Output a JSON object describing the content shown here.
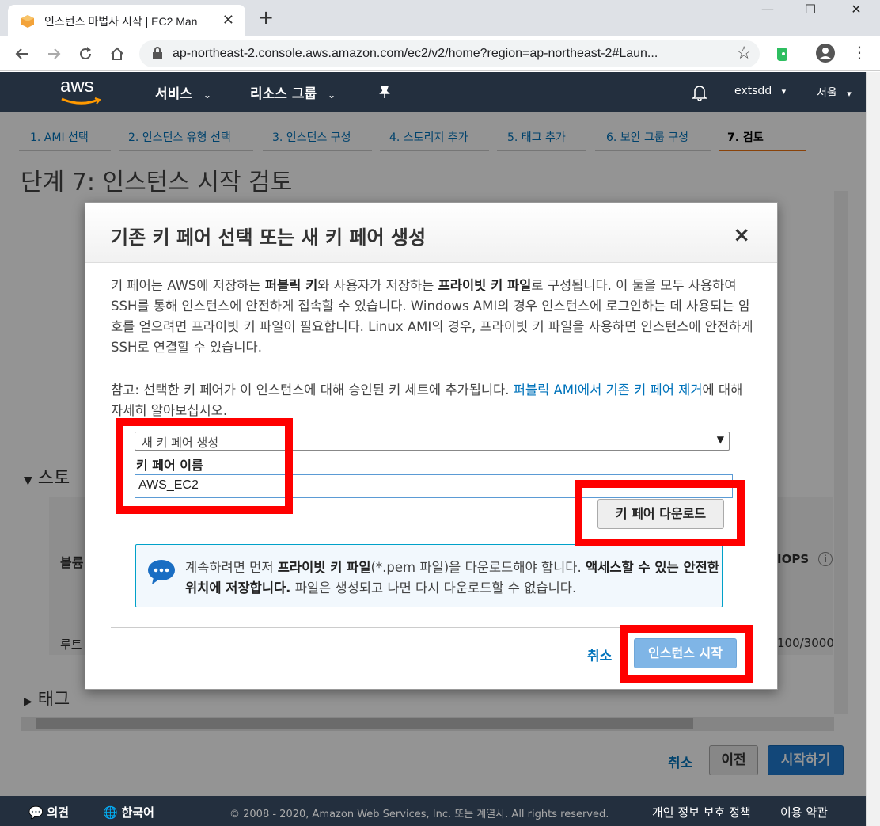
{
  "browser": {
    "tab_title": "인스턴스 마법사 시작 | EC2 Man",
    "tab_close": "✕",
    "new_tab": "+",
    "url": "ap-northeast-2.console.aws.amazon.com/ec2/v2/home?region=ap-northeast-2#Laun...",
    "minimize": "—",
    "maximize": "☐",
    "close": "✕"
  },
  "aws_header": {
    "logo": "aws",
    "services": "서비스",
    "resource_groups": "리소스 그룹",
    "account": "extsdd",
    "region": "서울"
  },
  "wizard": {
    "steps": [
      "1. AMI 선택",
      "2. 인스턴스 유형 선택",
      "3. 인스턴스 구성",
      "4. 스토리지 추가",
      "5. 태그 추가",
      "6. 보안 그룹 구성",
      "7. 검토"
    ],
    "title": "단계 7: 인스턴스 시작 검토",
    "storage_section": "스토",
    "tags_section": "태그",
    "table_col_volume": "볼륨",
    "table_col_iops": "IOPS",
    "table_row_root": "루트",
    "table_row_iops": "100/3000",
    "cancel": "취소",
    "previous": "이전",
    "launch": "시작하기"
  },
  "modal": {
    "title": "기존 키 페어 선택 또는 새 키 페어 생성",
    "close": "×",
    "para1_a": "키 페어는 AWS에 저장하는 ",
    "para1_b": "퍼블릭 키",
    "para1_c": "와 사용자가 저장하는 ",
    "para1_d": "프라이빗 키 파일",
    "para1_e": "로 구성됩니다. 이 둘을 모두 사용하여 SSH를 통해 인스턴스에 안전하게 접속할 수 있습니다. Windows AMI의 경우 인스턴스에 로그인하는 데 사용되는 암호를 얻으려면 프라이빗 키 파일이 필요합니다. Linux AMI의 경우, 프라이빗 키 파일을 사용하면 인스턴스에 안전하게 SSH로 연결할 수 있습니다.",
    "para2_a": "참고: 선택한 키 페어가 이 인스턴스에 대해 승인된 키 세트에 추가됩니다. ",
    "para2_link": "퍼블릭 AMI에서 기존 키 페어 제거",
    "para2_b": "에 대해 자세히 알아보십시오.",
    "select_value": "새 키 페어 생성",
    "key_pair_label": "키 페어 이름",
    "key_pair_value": "AWS_EC2",
    "download_button": "키 페어 다운로드",
    "info_a": "계속하려면 먼저 ",
    "info_b": "프라이빗 키 파일",
    "info_c": "(*.pem 파일)을 다운로드해야 합니다. ",
    "info_d": "액세스할 수 있는 안전한 위치에 저장합니다.",
    "info_e": " 파일은 생성되고 나면 다시 다운로드할 수 없습니다.",
    "cancel": "취소",
    "launch_instance": "인스턴스 시작"
  },
  "footer": {
    "feedback": "의견",
    "language": "한국어",
    "copyright": "© 2008 - 2020, Amazon Web Services, Inc. 또는 계열사. All rights reserved.",
    "privacy": "개인 정보 보호 정책",
    "terms": "이용 약관"
  },
  "colors": {
    "aws_dark": "#232f3e",
    "link_blue": "#0073bb",
    "highlight_red": "#ff0000"
  }
}
